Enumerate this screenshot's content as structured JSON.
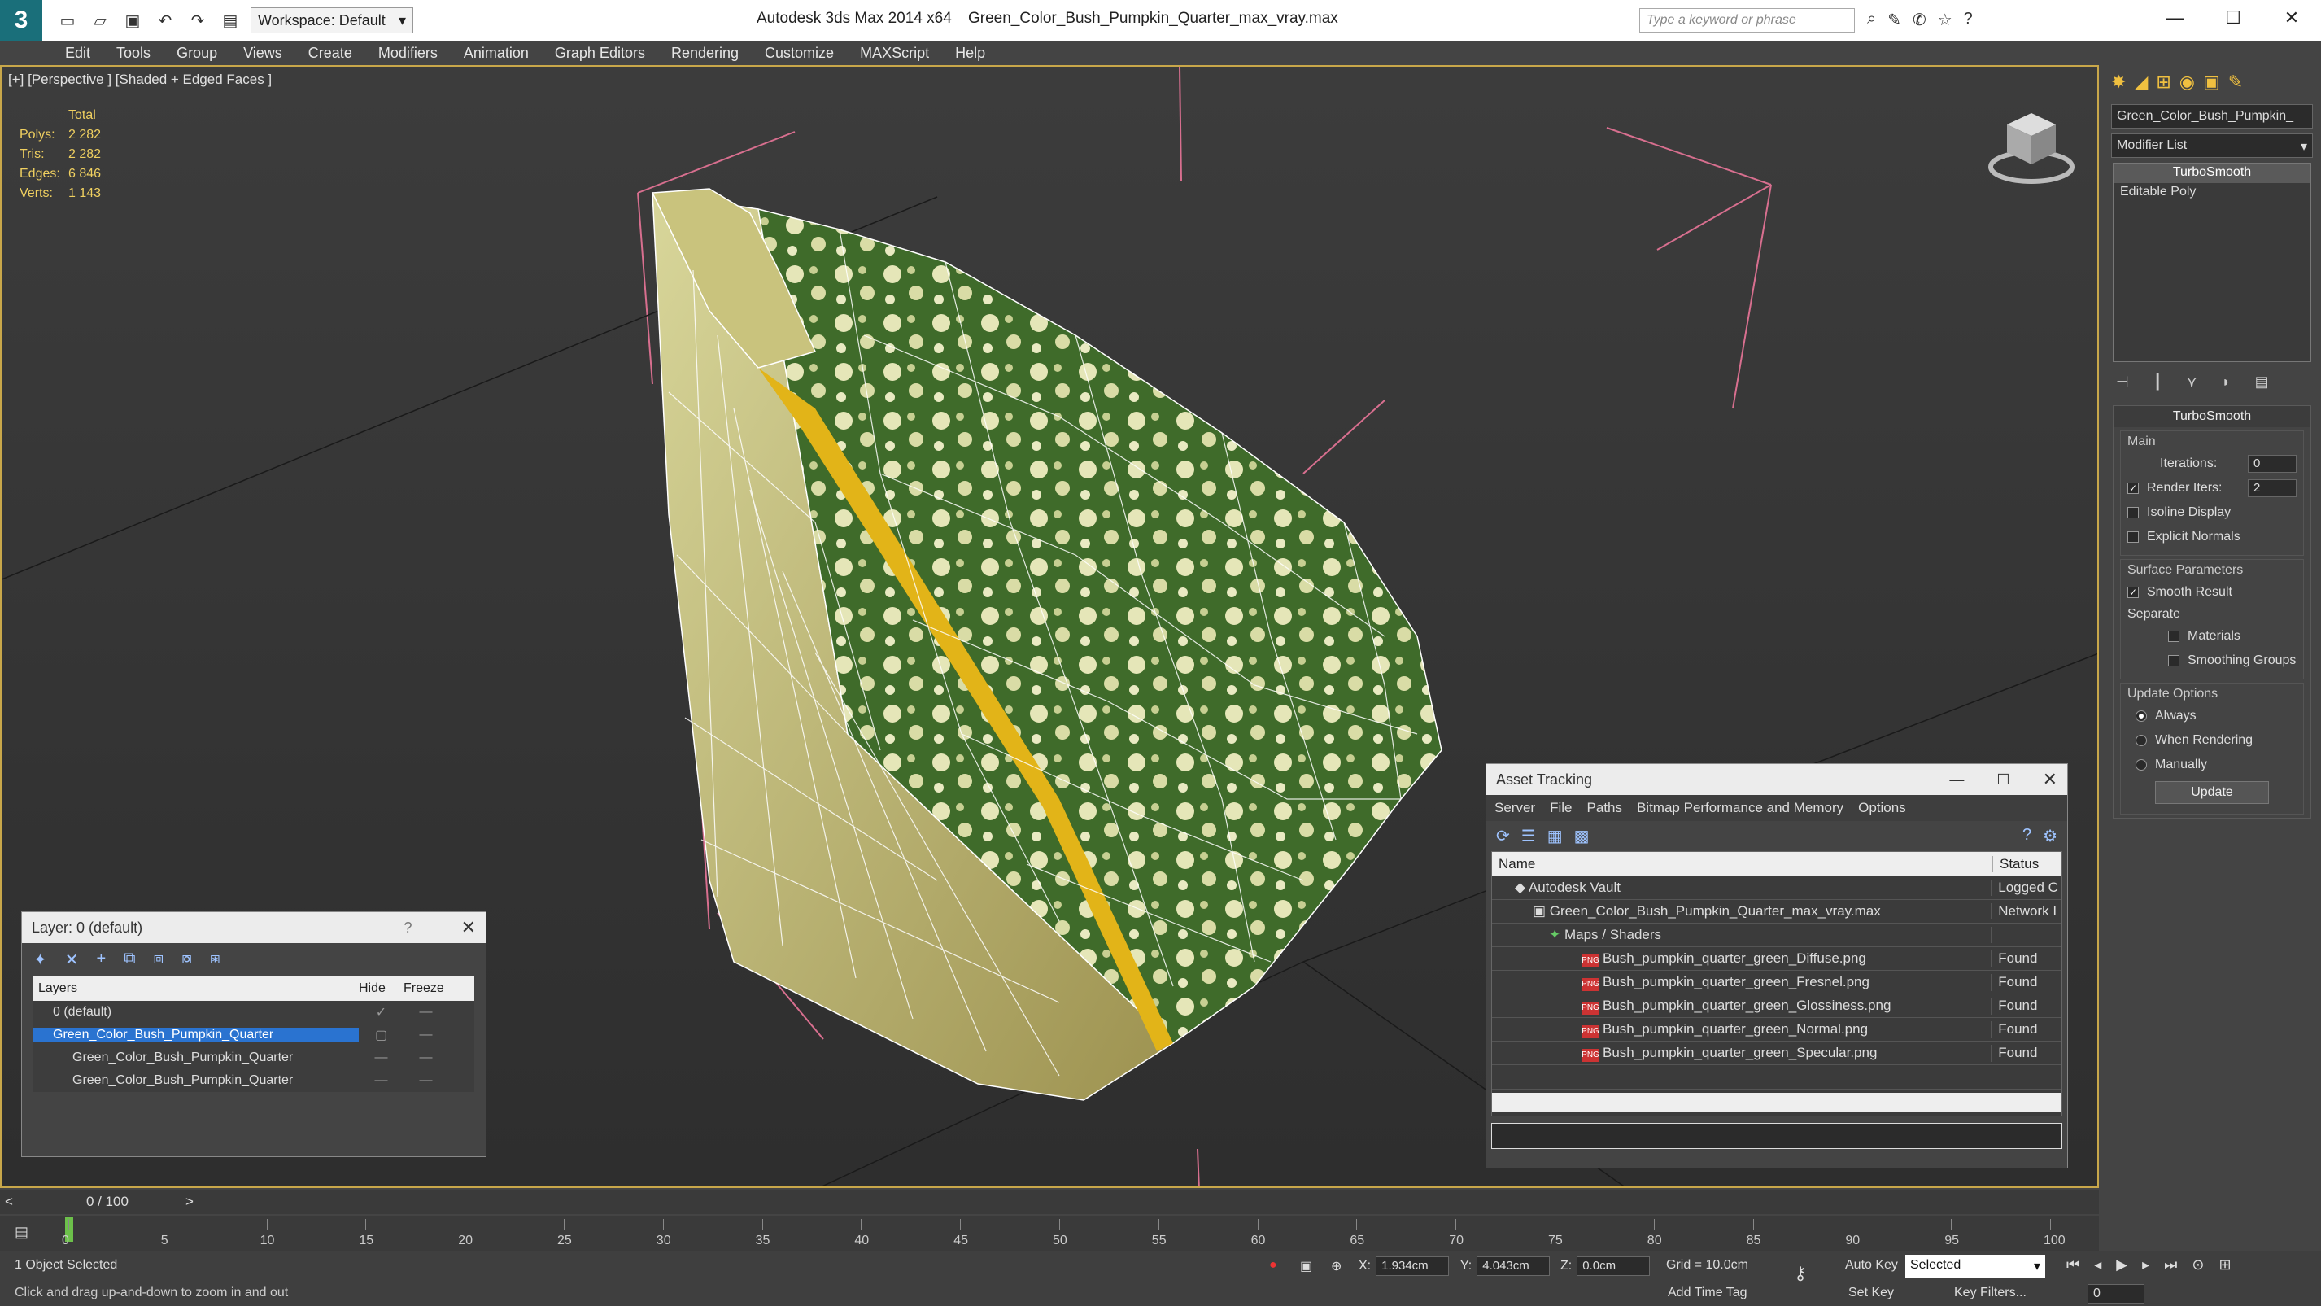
{
  "title_bar": {
    "workspace": "Workspace: Default",
    "app_title": "Autodesk 3ds Max  2014 x64",
    "file_name": "Green_Color_Bush_Pumpkin_Quarter_max_vray.max",
    "search_placeholder": "Type a keyword or phrase"
  },
  "menu": [
    "Edit",
    "Tools",
    "Group",
    "Views",
    "Create",
    "Modifiers",
    "Animation",
    "Graph Editors",
    "Rendering",
    "Customize",
    "MAXScript",
    "Help"
  ],
  "viewport": {
    "label": "[+] [Perspective ] [Shaded + Edged Faces ]",
    "stats": {
      "header": "Total",
      "rows": [
        {
          "k": "Polys:",
          "v": "2 282"
        },
        {
          "k": "Tris:",
          "v": "2 282"
        },
        {
          "k": "Edges:",
          "v": "6 846"
        },
        {
          "k": "Verts:",
          "v": "1 143"
        }
      ]
    }
  },
  "command_panel": {
    "object_name": "Green_Color_Bush_Pumpkin_",
    "modifier_list": "Modifier List",
    "stack": [
      "TurboSmooth",
      "Editable Poly"
    ],
    "rollout_title": "TurboSmooth",
    "main_label": "Main",
    "iterations_label": "Iterations:",
    "iterations_value": "0",
    "render_iters_label": "Render Iters:",
    "render_iters_value": "2",
    "isoline": "Isoline Display",
    "explicit": "Explicit Normals",
    "surface_params": "Surface Parameters",
    "smooth_result": "Smooth Result",
    "separate": "Separate",
    "materials": "Materials",
    "smoothing_groups": "Smoothing Groups",
    "update_options": "Update Options",
    "always": "Always",
    "when_rendering": "When Rendering",
    "manually": "Manually",
    "update_btn": "Update"
  },
  "layer_window": {
    "title": "Layer: 0 (default)",
    "help": "?",
    "col_layers": "Layers",
    "col_hide": "Hide",
    "col_freeze": "Freeze",
    "rows": [
      {
        "name": "0 (default)"
      },
      {
        "name": "Green_Color_Bush_Pumpkin_Quarter"
      },
      {
        "name": "Green_Color_Bush_Pumpkin_Quarter"
      },
      {
        "name": "Green_Color_Bush_Pumpkin_Quarter"
      }
    ]
  },
  "asset_window": {
    "title": "Asset Tracking",
    "menu": [
      "Server",
      "File",
      "Paths",
      "Bitmap Performance and Memory",
      "Options"
    ],
    "col_name": "Name",
    "col_status": "Status",
    "rows": [
      {
        "name": "Autodesk Vault",
        "status": "Logged C"
      },
      {
        "name": "Green_Color_Bush_Pumpkin_Quarter_max_vray.max",
        "status": "Network I"
      },
      {
        "name": "Maps / Shaders",
        "status": ""
      },
      {
        "name": "Bush_pumpkin_quarter_green_Diffuse.png",
        "status": "Found"
      },
      {
        "name": "Bush_pumpkin_quarter_green_Fresnel.png",
        "status": "Found"
      },
      {
        "name": "Bush_pumpkin_quarter_green_Glossiness.png",
        "status": "Found"
      },
      {
        "name": "Bush_pumpkin_quarter_green_Normal.png",
        "status": "Found"
      },
      {
        "name": "Bush_pumpkin_quarter_green_Specular.png",
        "status": "Found"
      }
    ]
  },
  "timeline": {
    "frame_display": "0 / 100",
    "ticks": [
      "0",
      "5",
      "10",
      "15",
      "20",
      "25",
      "30",
      "35",
      "40",
      "45",
      "50",
      "55",
      "60",
      "65",
      "70",
      "75",
      "80",
      "85",
      "90",
      "95",
      "100"
    ]
  },
  "status": {
    "selected": "1 Object Selected",
    "prompt": "Click and drag up-and-down to zoom in and out",
    "x_label": "X:",
    "x_value": "1.934cm",
    "y_label": "Y:",
    "y_value": "4.043cm",
    "z_label": "Z:",
    "z_value": "0.0cm",
    "grid": "Grid = 10.0cm",
    "add_time_tag": "Add Time Tag",
    "auto_key": "Auto Key",
    "set_key": "Set Key",
    "selected_dd": "Selected",
    "key_filters": "Key Filters...",
    "frame": "0"
  },
  "colors": {
    "accent": "#c8a74a",
    "selection": "#2a73d0",
    "stats": "#f0d060"
  }
}
